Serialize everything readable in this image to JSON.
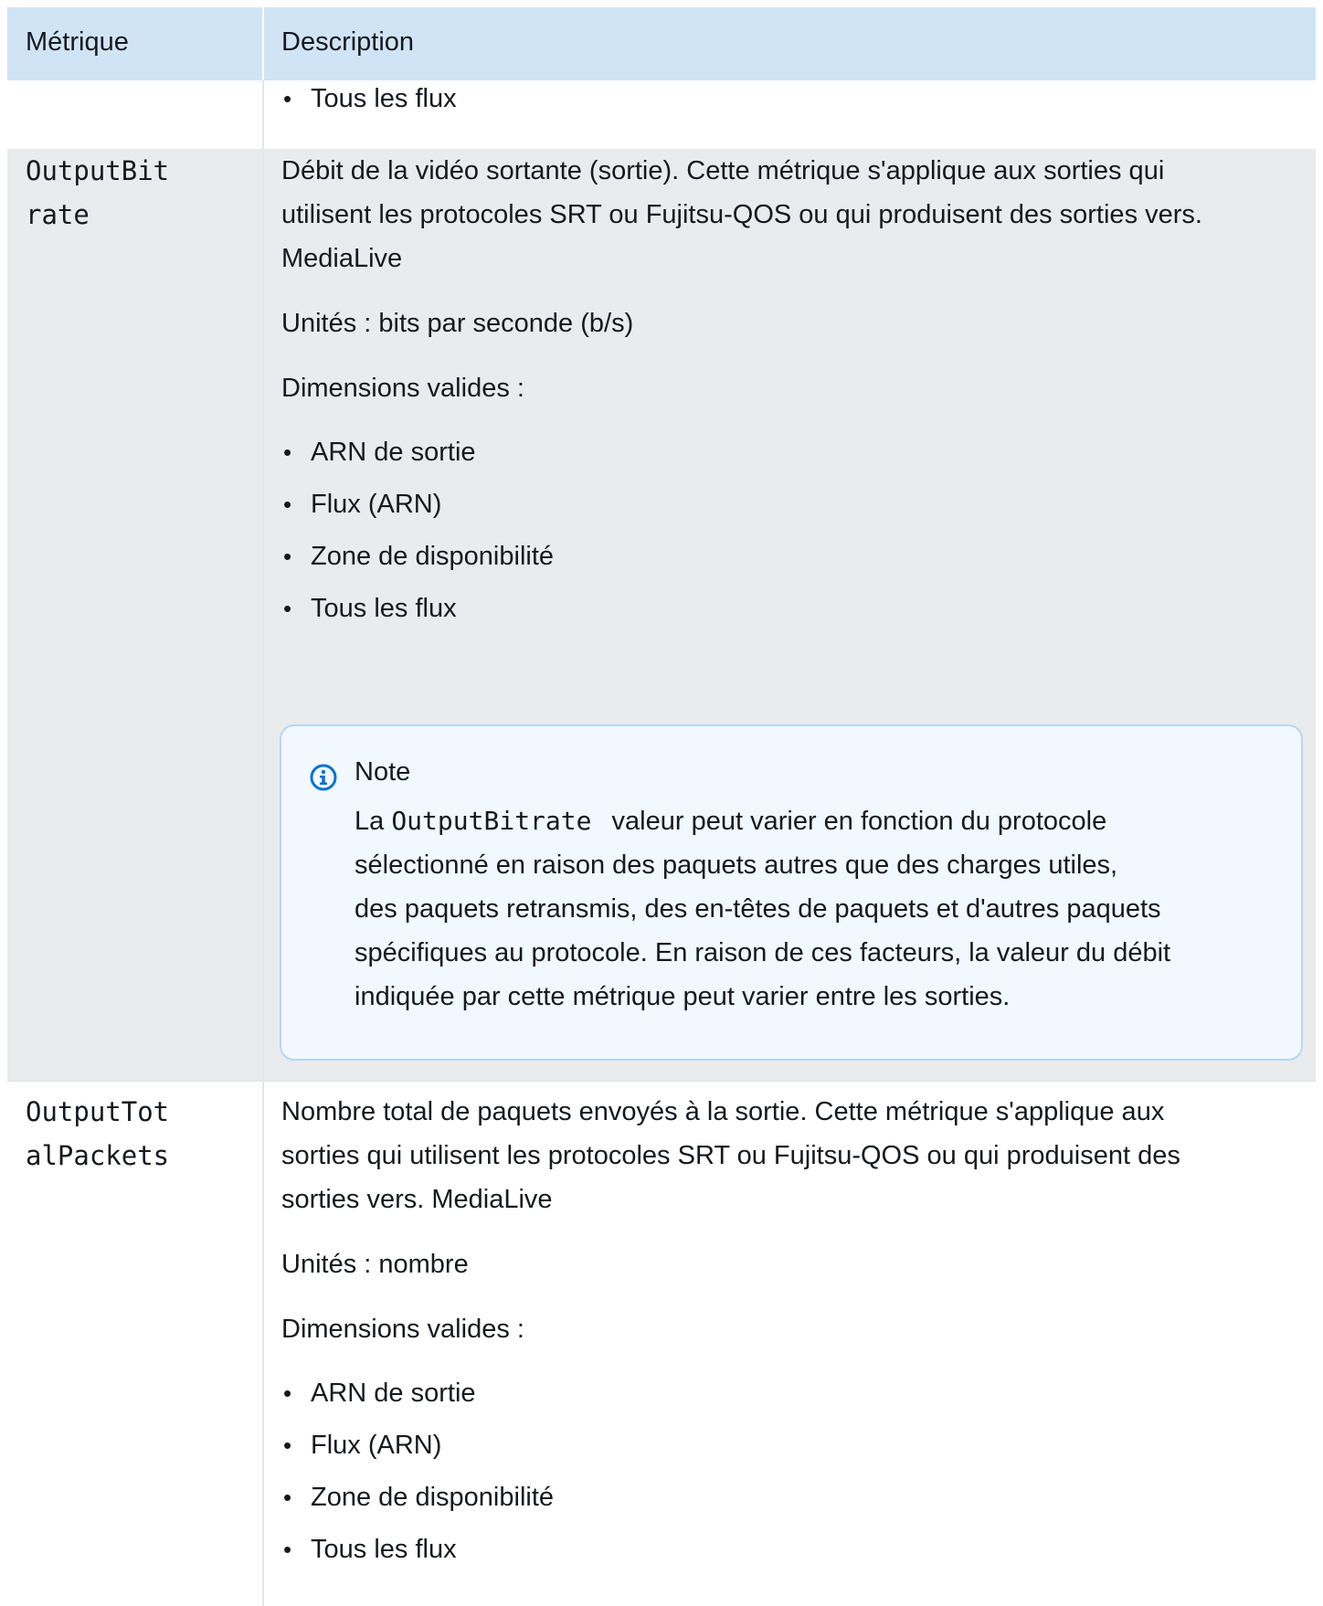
{
  "table": {
    "headers": {
      "metric": "Métrique",
      "description": "Description"
    },
    "row0": {
      "bullet": "Tous les flux"
    },
    "row1": {
      "metric_line1": "OutputBit",
      "metric_line2": "rate",
      "desc_line1": "Débit de la vidéo sortante (sortie). Cette métrique s'applique aux sorties qui",
      "desc_line2": "utilisent les protocoles SRT ou Fujitsu-QOS ou qui produisent des sorties vers.",
      "desc_line3": "MediaLive",
      "units": "Unités : bits par seconde (b/s)",
      "dimensions_label": "Dimensions valides :",
      "dimensions": [
        "ARN de sortie",
        "Flux (ARN)",
        "Zone de disponibilité",
        "Tous les flux"
      ],
      "note": {
        "icon": "info-icon",
        "title": "Note",
        "prefix": "La",
        "code": "OutputBitrate",
        "line1_rest": "valeur peut varier en fonction du protocole",
        "line2": "sélectionné en raison des paquets autres que des charges utiles,",
        "line3": "des paquets retransmis, des en-têtes de paquets et d'autres paquets",
        "line4": "spécifiques au protocole. En raison de ces facteurs, la valeur du débit",
        "line5": "indiquée par cette métrique peut varier entre les sorties."
      }
    },
    "row2": {
      "metric_line1": "OutputTot",
      "metric_line2": "alPackets",
      "desc_line1": "Nombre total de paquets envoyés à la sortie. Cette métrique s'applique aux",
      "desc_line2": "sorties qui utilisent les protocoles SRT ou Fujitsu-QOS ou qui produisent des",
      "desc_line3": "sorties vers. MediaLive",
      "units": "Unités : nombre",
      "dimensions_label": "Dimensions valides :",
      "dimensions": [
        "ARN de sortie",
        "Flux (ARN)",
        "Zone de disponibilité",
        "Tous les flux"
      ]
    }
  },
  "colors": {
    "header_bg": "#d1e4f6",
    "shaded_row_bg": "#e9ebed",
    "note_bg": "#f1f8ff",
    "note_border": "#b7d7f1",
    "info_icon": "#0972d3"
  }
}
